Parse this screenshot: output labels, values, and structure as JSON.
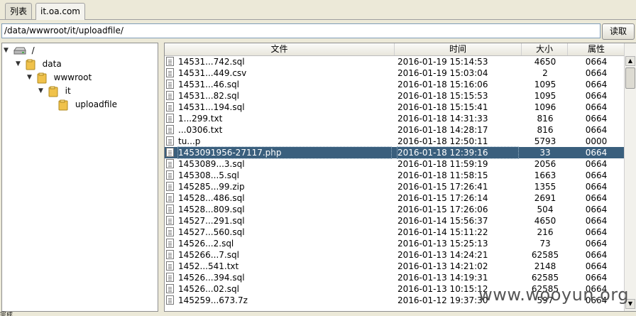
{
  "tabs": [
    {
      "label": "列表"
    },
    {
      "label": "it.oa.com"
    }
  ],
  "path": {
    "value": "/data/wwwroot/it/uploadfile/",
    "read_label": "读取"
  },
  "tree": [
    {
      "label": "/",
      "icon": "drive-icon"
    },
    {
      "label": "data",
      "icon": "folder-icon"
    },
    {
      "label": "wwwroot",
      "icon": "folder-icon"
    },
    {
      "label": "it",
      "icon": "folder-icon"
    },
    {
      "label": "uploadfile",
      "icon": "folder-icon"
    }
  ],
  "columns": {
    "name": "文件",
    "time": "时间",
    "size": "大小",
    "attr": "属性"
  },
  "files": [
    {
      "name": "14531...742.sql",
      "time": "2016-01-19 15:14:53",
      "size": "4650",
      "attr": "0664"
    },
    {
      "name": "14531...449.csv",
      "time": "2016-01-19 15:03:04",
      "size": "2",
      "attr": "0664"
    },
    {
      "name": "14531...46.sql",
      "time": "2016-01-18 15:16:06",
      "size": "1095",
      "attr": "0664"
    },
    {
      "name": "14531...82.sql",
      "time": "2016-01-18 15:15:53",
      "size": "1095",
      "attr": "0664"
    },
    {
      "name": "14531...194.sql",
      "time": "2016-01-18 15:15:41",
      "size": "1096",
      "attr": "0664"
    },
    {
      "name": "1...299.txt",
      "time": "2016-01-18 14:31:33",
      "size": "816",
      "attr": "0664"
    },
    {
      "name": "...0306.txt",
      "time": "2016-01-18 14:28:17",
      "size": "816",
      "attr": "0664"
    },
    {
      "name": "tu...p",
      "time": "2016-01-18 12:50:11",
      "size": "5793",
      "attr": "0000"
    },
    {
      "name": "1453091956-27117.php",
      "time": "2016-01-18 12:39:16",
      "size": "33",
      "attr": "0664",
      "selected": true
    },
    {
      "name": "1453089...3.sql",
      "time": "2016-01-18 11:59:19",
      "size": "2056",
      "attr": "0664"
    },
    {
      "name": "145308...5.sql",
      "time": "2016-01-18 11:58:15",
      "size": "1663",
      "attr": "0664"
    },
    {
      "name": "145285...99.zip",
      "time": "2016-01-15 17:26:41",
      "size": "1355",
      "attr": "0664"
    },
    {
      "name": "14528...486.sql",
      "time": "2016-01-15 17:26:14",
      "size": "2691",
      "attr": "0664"
    },
    {
      "name": "14528...809.sql",
      "time": "2016-01-15 17:26:06",
      "size": "504",
      "attr": "0664"
    },
    {
      "name": "14527...291.sql",
      "time": "2016-01-14 15:56:37",
      "size": "4650",
      "attr": "0664"
    },
    {
      "name": "14527...560.sql",
      "time": "2016-01-14 15:11:22",
      "size": "216",
      "attr": "0664"
    },
    {
      "name": "14526...2.sql",
      "time": "2016-01-13 15:25:13",
      "size": "73",
      "attr": "0664"
    },
    {
      "name": "145266...7.sql",
      "time": "2016-01-13 14:24:21",
      "size": "62585",
      "attr": "0664"
    },
    {
      "name": "1452...541.txt",
      "time": "2016-01-13 14:21:02",
      "size": "2148",
      "attr": "0664"
    },
    {
      "name": "14526...394.sql",
      "time": "2016-01-13 14:19:31",
      "size": "62585",
      "attr": "0664"
    },
    {
      "name": "14526...02.sql",
      "time": "2016-01-13 10:15:12",
      "size": "62585",
      "attr": "0664"
    },
    {
      "name": "145259...673.7z",
      "time": "2016-01-12 19:37:30",
      "size": "597",
      "attr": "0664"
    }
  ],
  "status": "完成",
  "watermark": "www.wooyun.org"
}
